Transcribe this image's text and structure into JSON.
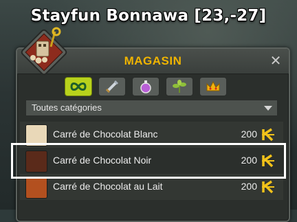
{
  "map": {
    "title": "Stayfun Bonnawa [23,-27]"
  },
  "shop": {
    "title": "MAGASIN",
    "close_label": "✕",
    "icon": "merchant-portrait-icon",
    "tabs": [
      {
        "icon": "infinity-icon",
        "active": true
      },
      {
        "icon": "sword-icon",
        "active": false
      },
      {
        "icon": "potion-icon",
        "active": false
      },
      {
        "icon": "plant-icon",
        "active": false
      },
      {
        "icon": "crown-icon",
        "active": false
      }
    ],
    "category": {
      "selected": "Toutes catégories"
    },
    "items": [
      {
        "name": "Carré de Chocolat Blanc",
        "price": "200",
        "icon": "white-chocolate-icon",
        "icon_color": "#e9d8b8"
      },
      {
        "name": "Carré de Chocolat Noir",
        "price": "200",
        "icon": "dark-chocolate-icon",
        "icon_color": "#5a2a1a",
        "selected": true
      },
      {
        "name": "Carré de Chocolat au Lait",
        "price": "200",
        "icon": "milk-chocolate-icon",
        "icon_color": "#b3501f"
      }
    ],
    "currency_icon": "kama-icon"
  },
  "colors": {
    "accent": "#f0b400",
    "tab_active": "#b8d21c",
    "highlight": "#ffffff"
  }
}
